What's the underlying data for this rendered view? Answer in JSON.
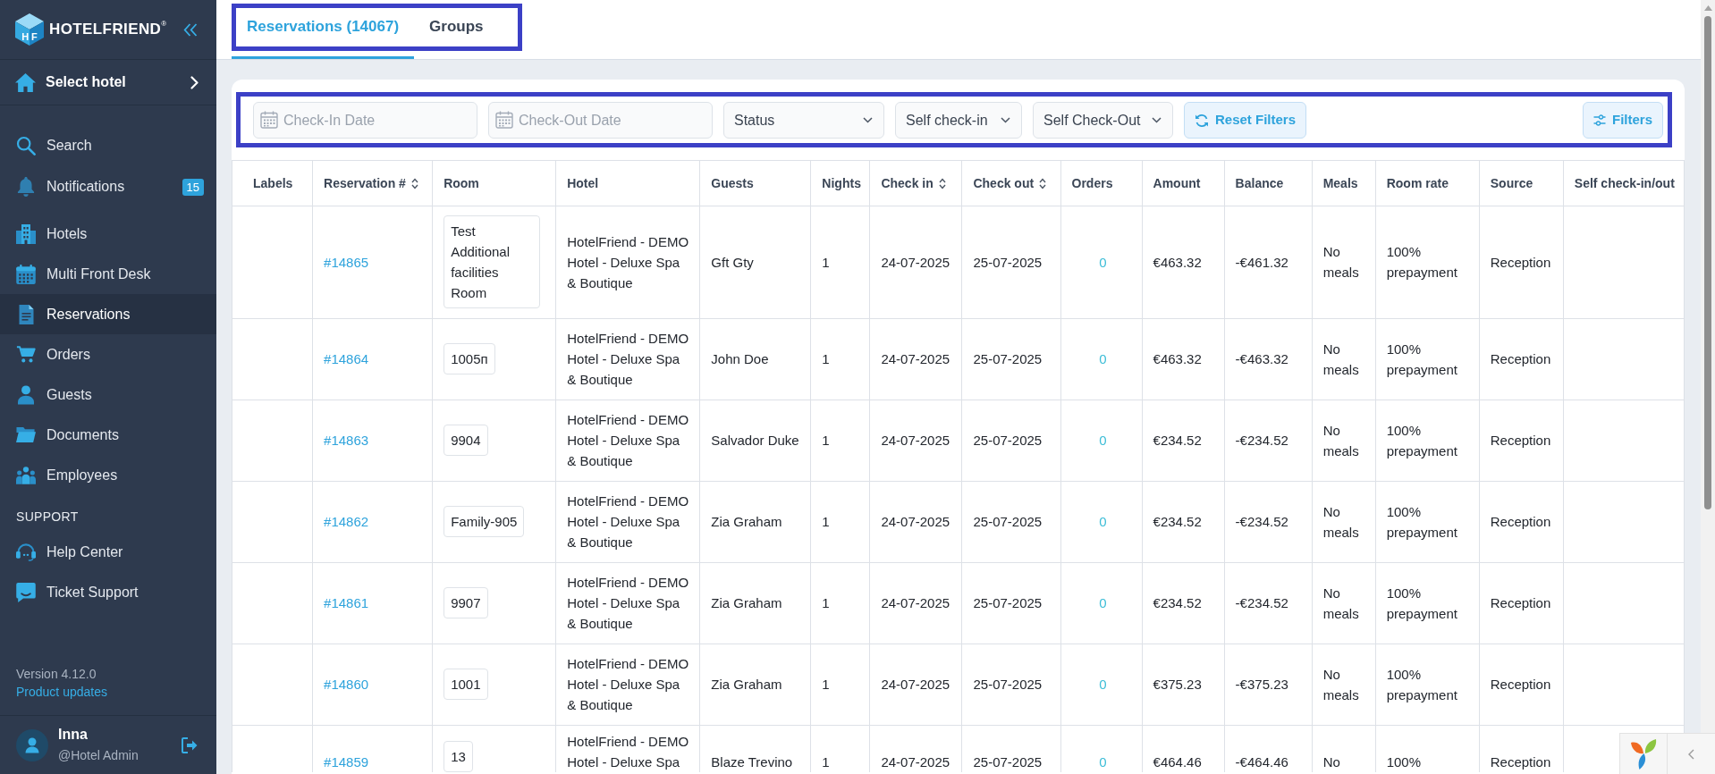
{
  "sidebar": {
    "brand": "HOTELFRIEND$^{®}$",
    "monogram": "HF",
    "hotel_selector": "Select hotel",
    "quick_items": [
      {
        "label": "Search",
        "selected": false
      },
      {
        "label": "Notifications",
        "selected": false,
        "badge": "15"
      }
    ],
    "nav_items": [
      {
        "label": "Hotels",
        "selected": false
      },
      {
        "label": "Multi Front Desk",
        "selected": false
      },
      {
        "label": "Reservations",
        "selected": true
      },
      {
        "label": "Orders",
        "selected": false
      },
      {
        "label": "Guests",
        "selected": false
      },
      {
        "label": "Documents",
        "selected": false
      },
      {
        "label": "Employees",
        "selected": false
      }
    ],
    "support": {
      "heading": "SUPPORT",
      "items": [
        {
          "label": "Help Center",
          "selected": false
        },
        {
          "label": "Ticket Support",
          "selected": false
        }
      ]
    },
    "version": "Version 4.12.0",
    "updates_link": "Product updates",
    "user": {
      "name": "Inna",
      "role": "@Hotel Admin"
    }
  },
  "tabs_bar": {
    "highlighted": true,
    "tabs": [
      {
        "label": "Reservations (14067)",
        "selected": true
      },
      {
        "label": "Groups",
        "selected": false
      }
    ]
  },
  "filter_bar": {
    "highlighted": true,
    "controls": [
      {
        "kind": "date",
        "placeholder": "Check-In Date"
      },
      {
        "kind": "date",
        "placeholder": "Check-Out Date"
      },
      {
        "kind": "select",
        "value": "Status"
      },
      {
        "kind": "select",
        "value": "Self check-in"
      },
      {
        "kind": "select",
        "value": "Self Check-Out"
      },
      {
        "kind": "reset",
        "label": "Reset Filters"
      },
      {
        "kind": "filters",
        "label": "Filters"
      }
    ]
  },
  "table": {
    "columns": [
      {
        "label": "Labels",
        "sortable": false
      },
      {
        "label": "Reservation #",
        "sortable": true
      },
      {
        "label": "Room",
        "sortable": false
      },
      {
        "label": "Hotel",
        "sortable": false
      },
      {
        "label": "Guests",
        "sortable": false
      },
      {
        "label": "Nights",
        "sortable": false
      },
      {
        "label": "Check in",
        "sortable": true
      },
      {
        "label": "Check out",
        "sortable": true
      },
      {
        "label": "Orders",
        "sortable": false
      },
      {
        "label": "Amount",
        "sortable": false
      },
      {
        "label": "Balance",
        "sortable": false
      },
      {
        "label": "Meals",
        "sortable": false
      },
      {
        "label": "Room rate",
        "sortable": false
      },
      {
        "label": "Source",
        "sortable": false
      },
      {
        "label": "Self check-in/out",
        "sortable": false
      }
    ],
    "rows": [
      {
        "reservation": "#14865",
        "room": "Test Additional facilities Room",
        "hotel": "HotelFriend - DEMO Hotel - Deluxe Spa & Boutique",
        "guests": "Gft Gty",
        "nights": "1",
        "check_in": "24-07-2025",
        "check_out": "25-07-2025",
        "orders": "0",
        "amount": "€463.32",
        "balance": "-€461.32",
        "meals": "No meals",
        "room_rate": "100% prepayment",
        "source": "Reception"
      },
      {
        "reservation": "#14864",
        "room": "1005п",
        "hotel": "HotelFriend - DEMO Hotel - Deluxe Spa & Boutique",
        "guests": "John Doe",
        "nights": "1",
        "check_in": "24-07-2025",
        "check_out": "25-07-2025",
        "orders": "0",
        "amount": "€463.32",
        "balance": "-€463.32",
        "meals": "No meals",
        "room_rate": "100% prepayment",
        "source": "Reception"
      },
      {
        "reservation": "#14863",
        "room": "9904",
        "hotel": "HotelFriend - DEMO Hotel - Deluxe Spa & Boutique",
        "guests": "Salvador Duke",
        "nights": "1",
        "check_in": "24-07-2025",
        "check_out": "25-07-2025",
        "orders": "0",
        "amount": "€234.52",
        "balance": "-€234.52",
        "meals": "No meals",
        "room_rate": "100% prepayment",
        "source": "Reception"
      },
      {
        "reservation": "#14862",
        "room": "Family-905",
        "hotel": "HotelFriend - DEMO Hotel - Deluxe Spa & Boutique",
        "guests": "Zia Graham",
        "nights": "1",
        "check_in": "24-07-2025",
        "check_out": "25-07-2025",
        "orders": "0",
        "amount": "€234.52",
        "balance": "-€234.52",
        "meals": "No meals",
        "room_rate": "100% prepayment",
        "source": "Reception"
      },
      {
        "reservation": "#14861",
        "room": "9907",
        "hotel": "HotelFriend - DEMO Hotel - Deluxe Spa & Boutique",
        "guests": "Zia Graham",
        "nights": "1",
        "check_in": "24-07-2025",
        "check_out": "25-07-2025",
        "orders": "0",
        "amount": "€234.52",
        "balance": "-€234.52",
        "meals": "No meals",
        "room_rate": "100% prepayment",
        "source": "Reception"
      },
      {
        "reservation": "#14860",
        "room": "1001",
        "hotel": "HotelFriend - DEMO Hotel - Deluxe Spa & Boutique",
        "guests": "Zia Graham",
        "nights": "1",
        "check_in": "24-07-2025",
        "check_out": "25-07-2025",
        "orders": "0",
        "amount": "€375.23",
        "balance": "-€375.23",
        "meals": "No meals",
        "room_rate": "100% prepayment",
        "source": "Reception"
      },
      {
        "reservation": "#14859",
        "room": "13",
        "hotel": "HotelFriend - DEMO Hotel - Deluxe Spa",
        "guests": "Blaze Trevino",
        "nights": "1",
        "check_in": "24-07-2025",
        "check_out": "25-07-2025",
        "orders": "0",
        "amount": "€464.46",
        "balance": "-€464.46",
        "meals": "No",
        "room_rate": "100%",
        "source": "Reception"
      }
    ]
  }
}
